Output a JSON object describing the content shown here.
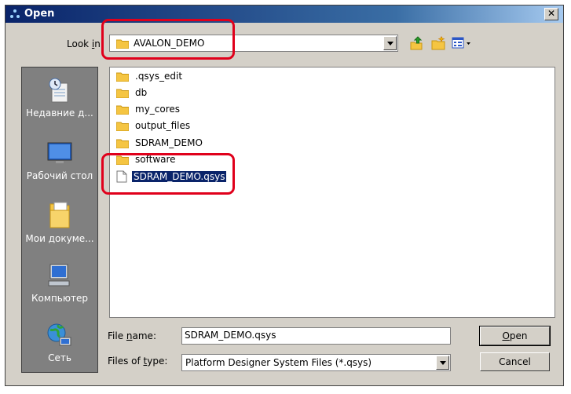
{
  "window": {
    "title": "Open",
    "close_glyph": "✕"
  },
  "look_in": {
    "label_before": "Look ",
    "label_accel": "i",
    "label_after": "n:",
    "value": "AVALON_DEMO"
  },
  "toolbar": {
    "icons": [
      "up-folder-icon",
      "new-folder-icon",
      "view-menu-icon"
    ]
  },
  "places": [
    {
      "label": "Недавние д...",
      "icon": "recent-documents-icon"
    },
    {
      "label": "Рабочий стол",
      "icon": "desktop-icon"
    },
    {
      "label": "Мои докуме...",
      "icon": "my-documents-icon"
    },
    {
      "label": "Компьютер",
      "icon": "computer-icon"
    },
    {
      "label": "Сеть",
      "icon": "network-icon"
    }
  ],
  "files": [
    {
      "name": ".qsys_edit",
      "type": "folder"
    },
    {
      "name": "db",
      "type": "folder"
    },
    {
      "name": "my_cores",
      "type": "folder"
    },
    {
      "name": "output_files",
      "type": "folder"
    },
    {
      "name": "SDRAM_DEMO",
      "type": "folder"
    },
    {
      "name": "software",
      "type": "folder"
    },
    {
      "name": "SDRAM_DEMO.qsys",
      "type": "file",
      "selected": true
    }
  ],
  "file_name": {
    "label_before": "File ",
    "label_accel": "n",
    "label_after": "ame:",
    "value": "SDRAM_DEMO.qsys"
  },
  "file_type": {
    "label_before": "Files of ",
    "label_accel": "t",
    "label_after": "ype:",
    "value": "Platform Designer System Files (*.qsys)"
  },
  "buttons": {
    "open_accel": "O",
    "open_rest": "pen",
    "cancel": "Cancel"
  },
  "colors": {
    "annotation_red": "#e0001b",
    "selection": "#0a246a",
    "folder": "#f5c542"
  }
}
